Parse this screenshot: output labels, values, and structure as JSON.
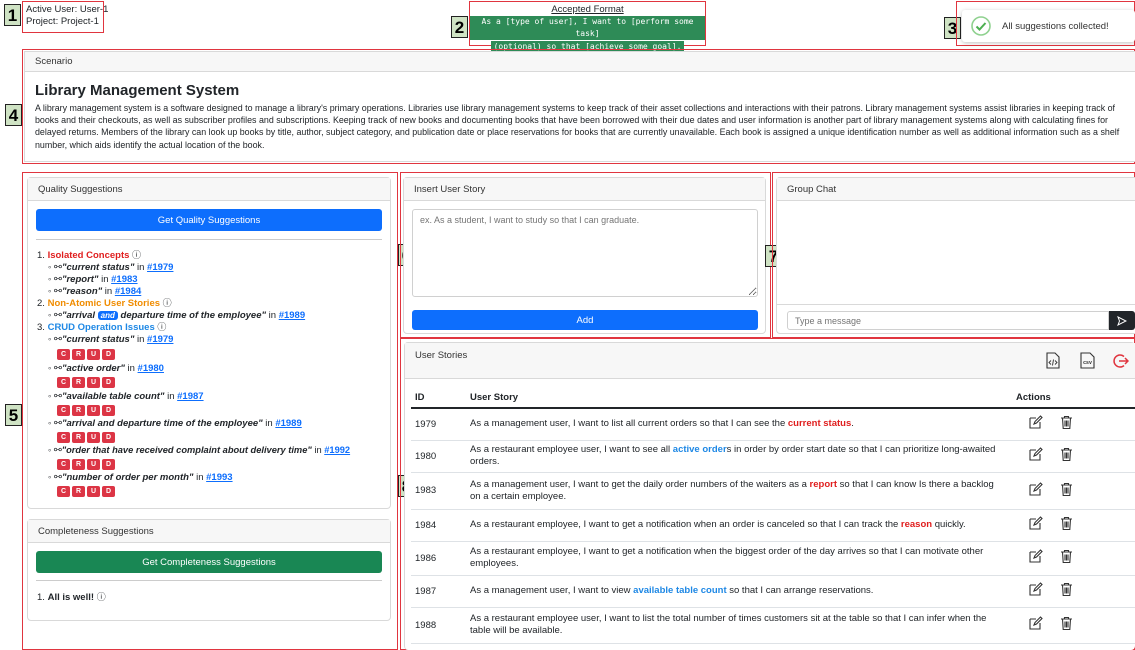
{
  "header": {
    "active_user": "Active User: User-1",
    "project": "Project: Project-1",
    "format_title": "Accepted Format",
    "format_line1": "As a [type of user], I want to [perform some task]",
    "format_line2": "(optional) so that [achieve some goal].",
    "status_text": "All suggestions collected!"
  },
  "markers": [
    "1",
    "2",
    "3",
    "4",
    "5",
    "6",
    "7",
    "8"
  ],
  "scenario": {
    "header": "Scenario",
    "title": "Library Management System",
    "text": "A library management system is a software designed to manage a library's primary operations. Libraries use library management systems to keep track of their asset collections and interactions with their patrons. Library management systems assist libraries in keeping track of books and their checkouts, as well as subscriber profiles and subscriptions. Keeping track of new books and documenting books that have been borrowed with their due dates and user information is another part of library management systems along with calculating fines for delayed returns. Members of the library can look up books by title, author, subject category, and publication date or place reservations for books that are currently unavailable. Each book is assigned a unique identification number as well as additional information such as a shelf number, which aids identify the actual location of the book."
  },
  "quality": {
    "header": "Quality Suggestions",
    "button": "Get Quality Suggestions",
    "categories": [
      {
        "num": "1.",
        "label": "Isolated Concepts",
        "color": "#e01e1e"
      },
      {
        "num": "2.",
        "label": "Non-Atomic User Stories",
        "color": "#f08c00"
      },
      {
        "num": "3.",
        "label": "CRUD Operation Issues",
        "color": "#1e88e5"
      }
    ],
    "isolated": [
      {
        "term": "\"current status\"",
        "in": "in",
        "link": "#1979"
      },
      {
        "term": "\"report\"",
        "in": "in",
        "link": "#1983"
      },
      {
        "term": "\"reason\"",
        "in": "in",
        "link": "#1984"
      }
    ],
    "nonatomic": {
      "pre": "\"arrival",
      "badge": "and",
      "post": "departure time of the employee\"",
      "in": "in",
      "link": "#1989"
    },
    "crud": [
      {
        "term": "\"current status\"",
        "in": "in",
        "link": "#1979"
      },
      {
        "term": "\"active order\"",
        "in": "in",
        "link": "#1980"
      },
      {
        "term": "\"available table count\"",
        "in": "in",
        "link": "#1987"
      },
      {
        "term": "\"arrival and departure time of the employee\"",
        "in": "in",
        "link": "#1989"
      },
      {
        "term": "\"order that have received complaint about delivery time\"",
        "in": "in",
        "link": "#1992"
      },
      {
        "term": "\"number of order per month\"",
        "in": "in",
        "link": "#1993"
      }
    ],
    "crud_letters": [
      "C",
      "R",
      "U",
      "D"
    ]
  },
  "completeness": {
    "header": "Completeness Suggestions",
    "button": "Get Completeness Suggestions",
    "item_num": "1.",
    "item": "All is well!"
  },
  "insert": {
    "header": "Insert User Story",
    "placeholder": "ex. As a student, I want to study so that I can graduate.",
    "button": "Add"
  },
  "chat": {
    "header": "Group Chat",
    "placeholder": "Type a message"
  },
  "stories": {
    "header": "User Stories",
    "col_id": "ID",
    "col_story": "User Story",
    "col_actions": "Actions",
    "icons": [
      "xml-export-icon",
      "csv-export-icon",
      "logout-icon"
    ],
    "csv_label": "csv",
    "rows": [
      {
        "id": "1979",
        "pre": "As a management user, I want to list all current orders so that I can see the ",
        "hl": "current status",
        "post": ".",
        "hl_color": "red"
      },
      {
        "id": "1980",
        "pre": "As a restaurant employee user, I want to see all ",
        "hl": "active order",
        "post": "s in order by order start date so that I can prioritize long-awaited orders.",
        "hl_color": "blue"
      },
      {
        "id": "1983",
        "pre": "As a management user, I want to get the daily order numbers of the waiters as a ",
        "hl": "report",
        "post": " so that I can know Is there a backlog on a certain employee.",
        "hl_color": "red"
      },
      {
        "id": "1984",
        "pre": "As a restaurant employee, I want to get a notification when an order is canceled so that I can track the ",
        "hl": "reason",
        "post": " quickly.",
        "hl_color": "red"
      },
      {
        "id": "1986",
        "pre": "As a restaurant employee, I want to get a notification when the biggest order of the day arrives so that I can motivate other employees.",
        "hl": "",
        "post": "",
        "hl_color": "red"
      },
      {
        "id": "1987",
        "pre": "As a management user, I want to view ",
        "hl": "available table count",
        "post": " so that I can arrange reservations.",
        "hl_color": "blue"
      },
      {
        "id": "1988",
        "pre": "As a restaurant employee user, I want to list the total number of times customers sit at the table so that I can infer when the table will be available.",
        "hl": "",
        "post": "",
        "hl_color": "red"
      }
    ]
  }
}
